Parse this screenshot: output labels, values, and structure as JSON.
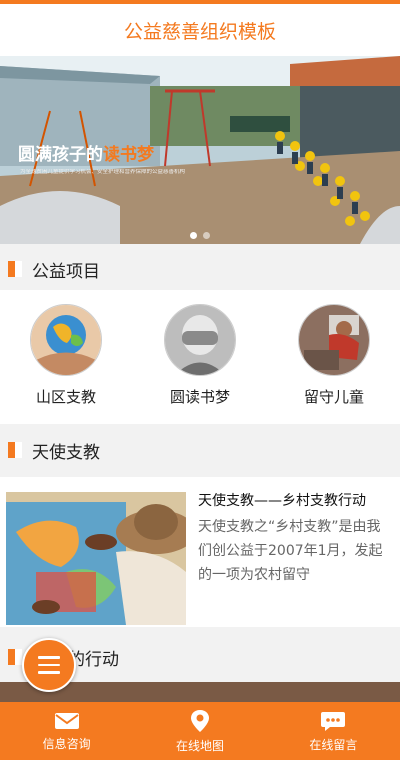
{
  "header": {
    "title": "公益慈善组织模板"
  },
  "banner": {
    "title_prefix": "圆满孩子的",
    "title_highlight": "读书梦",
    "subtitle": "为全球贫困儿童提供学习机会、安全护理和营养保障的公益慈善机构",
    "slides_total": 2,
    "slide_active": 1
  },
  "sections": {
    "projects": {
      "title": "公益项目"
    },
    "angel": {
      "title": "天使支教"
    },
    "action": {
      "title": "的行动"
    }
  },
  "projects": [
    {
      "label": "山区支教"
    },
    {
      "label": "圆读书梦"
    },
    {
      "label": "留守儿童"
    }
  ],
  "article": {
    "title": "天使支教——乡村支教行动",
    "body": "天使支教之“乡村支教”是由我们创公益于2007年1月，发起的一项为农村留守"
  },
  "bottom_nav": [
    {
      "label": "信息咨询",
      "icon": "mail-icon"
    },
    {
      "label": "在线地图",
      "icon": "map-pin-icon"
    },
    {
      "label": "在线留言",
      "icon": "chat-icon"
    }
  ],
  "colors": {
    "accent": "#f47a20",
    "background": "#f2f2f2"
  }
}
